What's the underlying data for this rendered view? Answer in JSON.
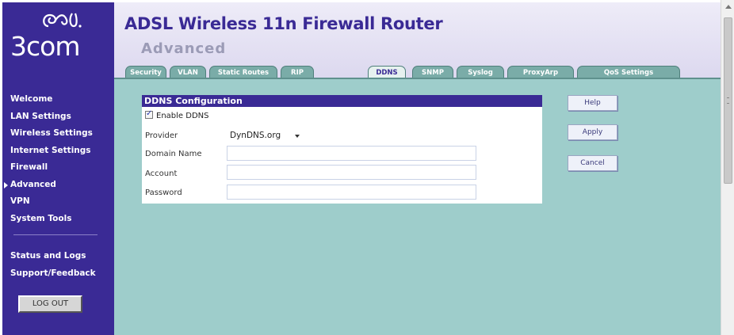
{
  "brand": {
    "logo_text": "3com"
  },
  "header": {
    "title": "ADSL Wireless 11n Firewall Router",
    "subtitle": "Advanced"
  },
  "tabs": [
    {
      "label": "Security"
    },
    {
      "label": "VLAN"
    },
    {
      "label": "Static Routes"
    },
    {
      "label": "RIP"
    },
    {
      "label": "DDNS",
      "active": true
    },
    {
      "label": "SNMP"
    },
    {
      "label": "Syslog"
    },
    {
      "label": "ProxyArp"
    },
    {
      "label": "QoS Settings"
    }
  ],
  "sidebar": {
    "items": [
      {
        "label": "Welcome"
      },
      {
        "label": "LAN Settings"
      },
      {
        "label": "Wireless Settings"
      },
      {
        "label": "Internet Settings"
      },
      {
        "label": "Firewall"
      },
      {
        "label": "Advanced",
        "active": true
      },
      {
        "label": "VPN"
      },
      {
        "label": "System Tools"
      }
    ],
    "secondary_items": [
      {
        "label": "Status and Logs"
      },
      {
        "label": "Support/Feedback"
      }
    ],
    "logout_label": "LOG OUT"
  },
  "panel": {
    "title": "DDNS Configuration",
    "enable_label": "Enable DDNS",
    "enable_checked": true,
    "provider_label": "Provider",
    "provider_value": "DynDNS.org",
    "domain_label": "Domain Name",
    "domain_value": "",
    "account_label": "Account",
    "account_value": "",
    "password_label": "Password",
    "password_value": ""
  },
  "buttons": {
    "help": "Help",
    "apply": "Apply",
    "cancel": "Cancel"
  },
  "colors": {
    "brand_purple": "#3a2a95",
    "content_bg": "#9ecdcb",
    "tab_teal": "#7aaca8"
  }
}
